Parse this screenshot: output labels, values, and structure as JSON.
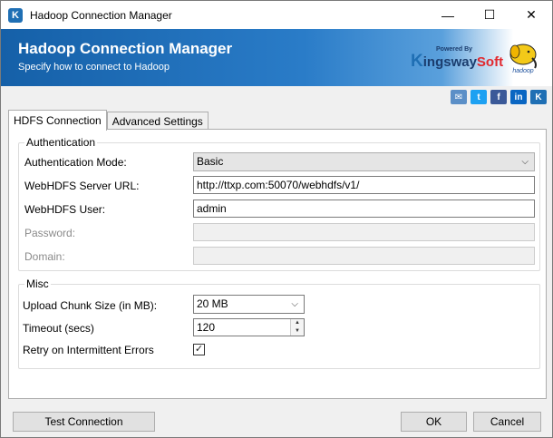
{
  "window": {
    "title": "Hadoop Connection Manager",
    "app_icon": "K",
    "minimize": "—",
    "maximize": "☐",
    "close": "✕"
  },
  "banner": {
    "title": "Hadoop Connection Manager",
    "subtitle": "Specify how to connect to Hadoop",
    "logo_powered": "Powered By",
    "logo_k": "K",
    "logo_ingsway": "ingsway",
    "logo_soft": "Soft",
    "hadoop_logo_text": "hadoop"
  },
  "social": {
    "email_glyph": "✉",
    "twitter_glyph": "t",
    "facebook_glyph": "f",
    "linkedin_glyph": "in",
    "kingsway_glyph": "K"
  },
  "tabs": [
    {
      "label": "HDFS Connection",
      "active": true
    },
    {
      "label": "Advanced Settings",
      "active": false
    }
  ],
  "auth": {
    "group_label": "Authentication",
    "mode_label": "Authentication Mode:",
    "mode_value": "Basic",
    "url_label": "WebHDFS Server URL:",
    "url_value": "http://ttxp.com:50070/webhdfs/v1/",
    "user_label": "WebHDFS User:",
    "user_value": "admin",
    "password_label": "Password:",
    "password_value": "",
    "domain_label": "Domain:",
    "domain_value": ""
  },
  "misc": {
    "group_label": "Misc",
    "chunk_label": "Upload Chunk Size (in MB):",
    "chunk_value": "20 MB",
    "timeout_label": "Timeout (secs)",
    "timeout_value": "120",
    "retry_label": "Retry on Intermittent Errors",
    "retry_checked": true,
    "check_glyph": "✓"
  },
  "buttons": {
    "test": "Test Connection",
    "ok": "OK",
    "cancel": "Cancel"
  },
  "colors": {
    "banner_start": "#1560a8",
    "banner_end": "#ffffff",
    "twitter": "#1da1f2",
    "facebook": "#3b5998",
    "linkedin": "#0a66c2",
    "email": "#5b8fc7",
    "kingsway": "#1f6fb4"
  }
}
